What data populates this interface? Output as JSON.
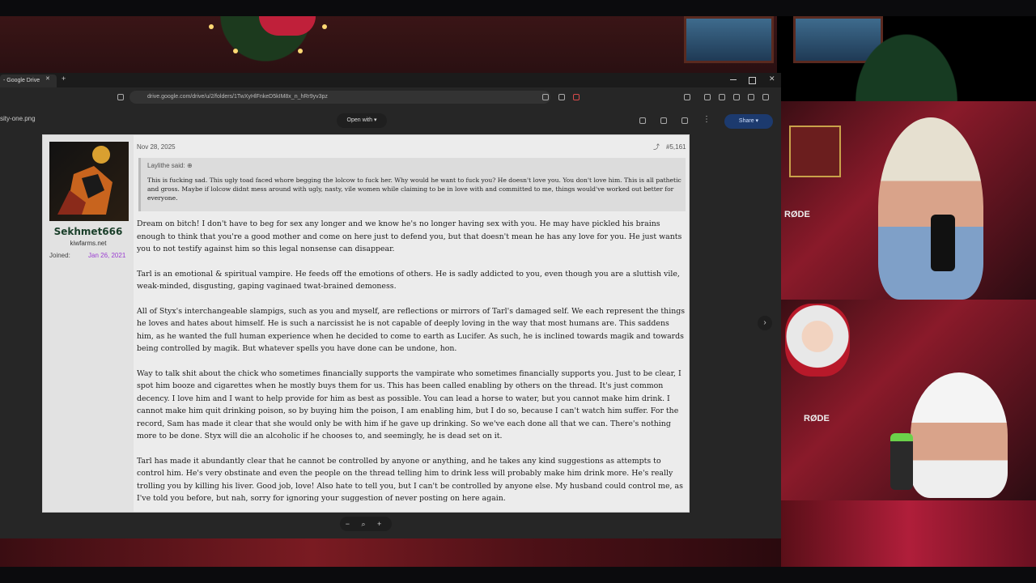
{
  "browser": {
    "tab_title": "- Google Drive",
    "tab_close": "✕",
    "new_tab": "+",
    "url": "drive.google.com/drive/u/2/folders/1TwXyHlFnkeD5kIM8x_n_hRr9yv3pz"
  },
  "viewer": {
    "filename": "sity-one.png",
    "open_with": "Open with",
    "share": "Share",
    "zoom_controls": "−  ⌕  +",
    "next_arrow": "›"
  },
  "post": {
    "username": "Sekhmet666",
    "site": "kiwfarms.net",
    "joined_label": "Joined:",
    "joined_date": "Jan 26, 2021",
    "date": "Nov 28, 2025",
    "post_number": "#5,161",
    "quote_author": "Laylithe said:",
    "quote_text": "This is fucking sad. This ugly toad faced whore begging the lolcow to fuck her. Why would he want to fuck you? He doesn't love you. You don't love him. This is all pathetic and gross. Maybe if lolcow didnt mess around with ugly, nasty, vile women while claiming to be in love with and committed to me, things would've worked out better for everyone.",
    "paragraphs": [
      "Dream on bitch! I don't have to beg for sex any longer and we know he's no longer having sex with you. He may have pickled his brains enough to think that you're a good mother and come on here just to defend you, but that doesn't mean he has any love for you. He just wants you to not testify against him so this legal nonsense can disappear.",
      "Tarl is an emotional & spiritual vampire. He feeds off the emotions of others. He is sadly addicted to you, even though you are a sluttish vile, weak-minded, disgusting, gaping vaginaed twat-brained demoness.",
      "All of Styx's interchangeable slampigs, such as you and myself, are reflections or mirrors of Tarl's damaged self. We each represent the things he loves and hates about himself. He is such a narcissist he is not capable of deeply loving in the way that most humans are. This saddens him, as he wanted the full human experience when he decided to come to earth as Lucifer. As such, he is inclined towards magik and towards being controlled by magik. But whatever spells you have done can be undone, hon.",
      "Way to talk shit about the chick who sometimes financially supports the vampirate who sometimes financially supports you. Just to be clear, I spot him booze and cigarettes when he mostly buys them for us. This has been called enabling by others on the thread. It's just common decency. I love him and I want to help provide for him as best as possible. You can lead a horse to water, but you cannot make him drink. I cannot make him quit drinking poison, so by buying him the poison, I am enabling him, but I do so, because I can't watch him suffer. For the record, Sam has made it clear that she would only be with him if he gave up drinking. So we've each done all that we can. There's nothing more to be done. Styx will die an alcoholic if he chooses to, and seemingly, he is dead set on it.",
      "Tarl has made it abundantly clear that he cannot be controlled by anyone or anything, and he takes any kind suggestions as attempts to control him. He's very obstinate and even the people on the thread telling him to drink less will probably make him drink more. He's really trolling you by killing his liver. Good job, love! Also hate to tell you, but I can't be controlled by anyone else. My husband could control me, as I've told you before, but nah, sorry for ignoring your suggestion of never posting on here again."
    ]
  },
  "stream": {
    "mic_label_top": "RØDE",
    "mic_label_bottom": "RØDE"
  },
  "colors": {
    "username": "#1a3f2a",
    "joined_date": "#9a3bd1",
    "share_button": "#1c3a6e"
  }
}
